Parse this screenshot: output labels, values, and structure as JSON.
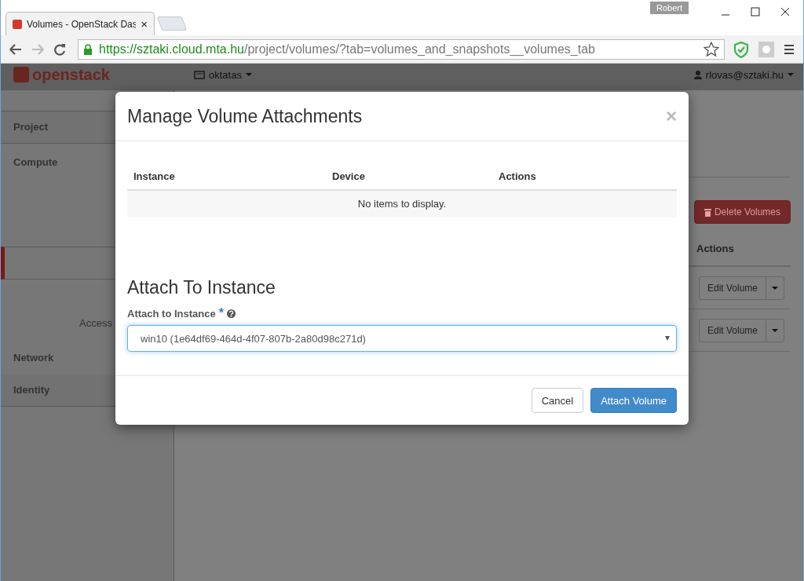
{
  "browser": {
    "tab_title": "Volumes - OpenStack Das",
    "close": "×",
    "user_badge": "Robert",
    "url_host": "https://sztaki.cloud.mta.hu",
    "url_path": "/project/volumes/?tab=volumes_and_snapshots__volumes_tab"
  },
  "header": {
    "logo": "openstack",
    "project": "oktatas",
    "user": "rlovas@sztaki.hu"
  },
  "sidebar": [
    {
      "kind": "dashboard",
      "label": "Project"
    },
    {
      "kind": "group",
      "label": "Compute"
    },
    {
      "kind": "item",
      "selected": true
    },
    {
      "kind": "item",
      "label": "Access",
      "selected": false
    },
    {
      "kind": "group",
      "label": "Network"
    },
    {
      "kind": "dashboard",
      "label": "Identity"
    }
  ],
  "content": {
    "delete_button": "Delete Volumes",
    "actions_column": "Actions",
    "rows": [
      {
        "action": "Edit Volume"
      },
      {
        "action": "Edit Volume"
      }
    ]
  },
  "modal": {
    "title": "Manage Volume Attachments",
    "close": "×",
    "columns": [
      "Instance",
      "Device",
      "Actions"
    ],
    "empty": "No items to display.",
    "section": "Attach To Instance",
    "field_label": "Attach to Instance",
    "required": "*",
    "select_value": "win10 (1e64df69-464d-4f07-807b-2a80d98c271d)",
    "buttons": [
      {
        "kind": "default",
        "label": "Cancel"
      },
      {
        "kind": "primary",
        "label": "Attach Volume"
      }
    ]
  }
}
